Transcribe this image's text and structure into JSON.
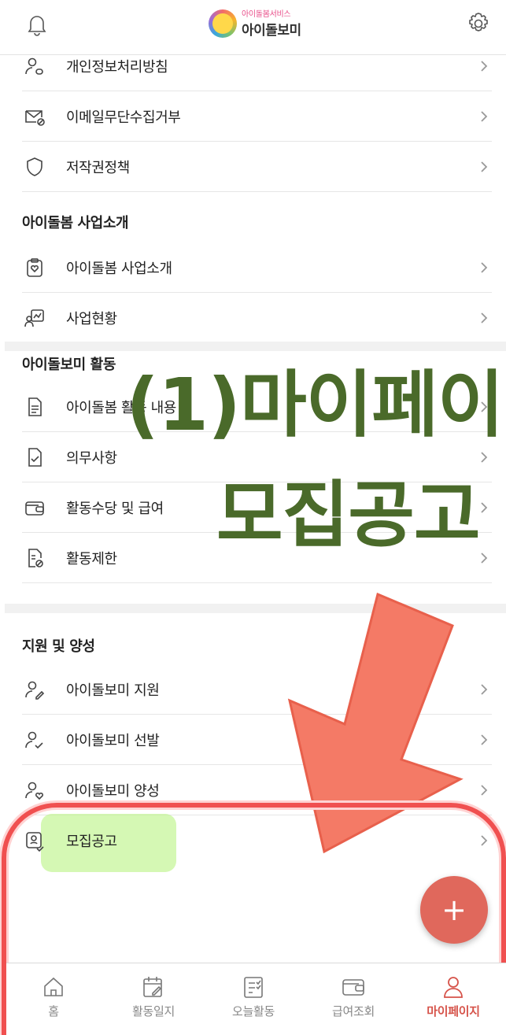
{
  "header": {
    "logo_sub": "아이돌봄서비스",
    "logo_name": "아이돌보미",
    "left_icon": "bell-icon",
    "right_icon": "gear-icon"
  },
  "list_top": [
    {
      "label": "개인정보처리방침",
      "icon": "user-lock-icon"
    },
    {
      "label": "이메일무단수집거부",
      "icon": "mail-block-icon"
    },
    {
      "label": "저작권정책",
      "icon": "shield-icon"
    }
  ],
  "section_business": {
    "title": "아이돌봄 사업소개",
    "items": [
      {
        "label": "아이돌봄 사업소개",
        "icon": "clipboard-heart-icon"
      },
      {
        "label": "사업현황",
        "icon": "chart-person-icon"
      }
    ]
  },
  "section_activity": {
    "title": "아이돌보미 활동",
    "items": [
      {
        "label": "아이돌봄 활동 내용",
        "icon": "document-icon"
      },
      {
        "label": "의무사항",
        "icon": "checklist-icon"
      },
      {
        "label": "활동수당 및 급여",
        "icon": "wallet-icon"
      },
      {
        "label": "활동제한",
        "icon": "document-block-icon"
      }
    ]
  },
  "section_support": {
    "title": "지원 및 양성",
    "items": [
      {
        "label": "아이돌보미 지원",
        "icon": "user-edit-icon"
      },
      {
        "label": "아이돌보미 선발",
        "icon": "user-check-icon"
      },
      {
        "label": "아이돌보미 양성",
        "icon": "user-heart-icon"
      },
      {
        "label": "모집공고",
        "icon": "recruit-board-icon"
      }
    ]
  },
  "overlay": {
    "line1": "(1)마이페이",
    "line2": "모집공고"
  },
  "fab_label": "+",
  "bottom_nav": [
    {
      "label": "홈",
      "icon": "home-icon",
      "active": false
    },
    {
      "label": "활동일지",
      "icon": "calendar-edit-icon",
      "active": false
    },
    {
      "label": "오늘활동",
      "icon": "checklist-icon",
      "active": false
    },
    {
      "label": "급여조회",
      "icon": "wallet-icon",
      "active": false
    },
    {
      "label": "마이페이지",
      "icon": "person-icon",
      "active": true
    }
  ],
  "colors": {
    "accent": "#d6534a",
    "overlay_text": "#4a6a2a",
    "fab": "#e0685c",
    "arrow": "#f47a66"
  }
}
